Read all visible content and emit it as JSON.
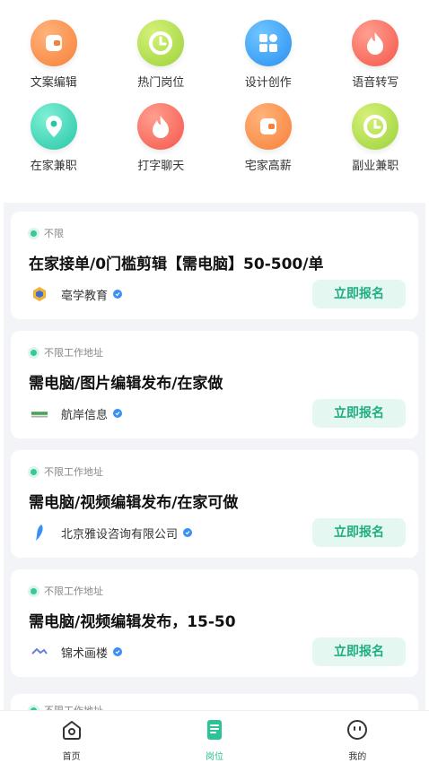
{
  "categories": [
    {
      "label": "文案编辑",
      "icon": "wallet-icon",
      "color": "#f7803a"
    },
    {
      "label": "热门岗位",
      "icon": "clock-icon",
      "color": "#9bd23a"
    },
    {
      "label": "设计创作",
      "icon": "apps-grid-icon",
      "color": "#2a8ff0"
    },
    {
      "label": "语音转写",
      "icon": "flame-icon",
      "color": "#f4554a"
    },
    {
      "label": "在家兼职",
      "icon": "location-pin-icon",
      "color": "#27c6a6"
    },
    {
      "label": "打字聊天",
      "icon": "flame-icon",
      "color": "#f4554a"
    },
    {
      "label": "宅家高薪",
      "icon": "wallet-icon",
      "color": "#f7803a"
    },
    {
      "label": "副业兼职",
      "icon": "clock-icon",
      "color": "#9bd23a"
    }
  ],
  "jobs": [
    {
      "tag": "不限",
      "title": "在家接单/0门槛剪辑【需电脑】50-500/单",
      "company": "亳学教育",
      "apply": "立即报名"
    },
    {
      "tag": "不限工作地址",
      "title": "需电脑/图片编辑发布/在家做",
      "company": "航岸信息",
      "apply": "立即报名"
    },
    {
      "tag": "不限工作地址",
      "title": "需电脑/视频编辑发布/在家可做",
      "company": "北京雅设咨询有限公司",
      "apply": "立即报名"
    },
    {
      "tag": "不限工作地址",
      "title": "需电脑/视频编辑发布，15-50",
      "company": "锦术画楼",
      "apply": "立即报名"
    },
    {
      "tag": "不限工作地址"
    }
  ],
  "tabs": [
    {
      "label": "首页",
      "icon": "home-icon"
    },
    {
      "label": "岗位",
      "icon": "document-icon",
      "active": true
    },
    {
      "label": "我的",
      "icon": "profile-face-icon"
    }
  ],
  "colors": {
    "accent": "#2ec297",
    "apply_bg": "#e4f7f0",
    "verified": "#3a8ff5"
  }
}
